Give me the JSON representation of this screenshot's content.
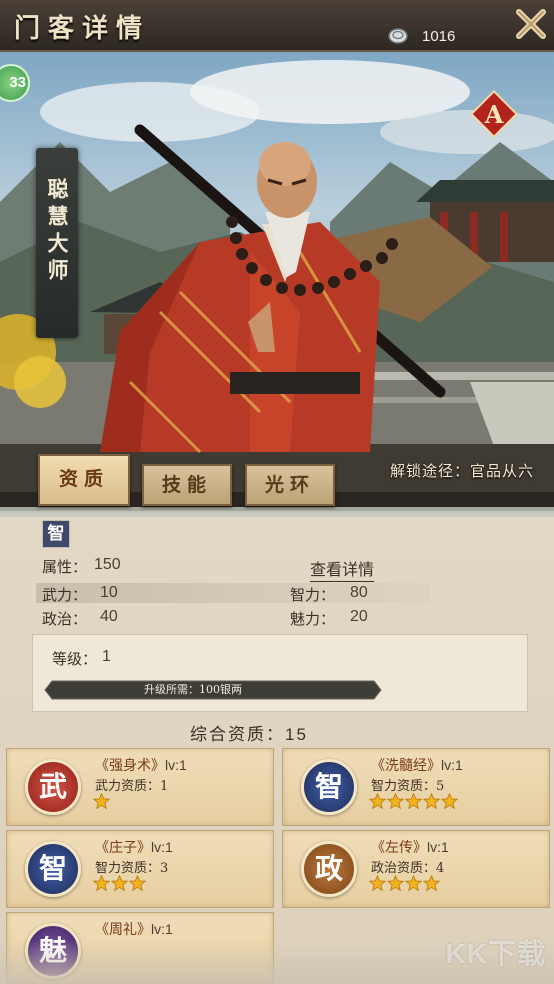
{
  "header": {
    "title": "门客详情",
    "currency_value": "1016",
    "currency_icon": "silver-coin-icon",
    "close_icon": "close-icon"
  },
  "hero": {
    "level": "33",
    "name": "聪慧大师",
    "rank": "A",
    "unlock_text": "解锁途径：官品从六"
  },
  "tabs": [
    {
      "label": "资质",
      "active": true
    },
    {
      "label": "技能",
      "active": false
    },
    {
      "label": "光环",
      "active": false
    }
  ],
  "attributes": {
    "type_icon": "智",
    "attr_label": "属性：",
    "attr_value": "150",
    "details_link": "查看详情",
    "stats": [
      {
        "label": "武力：",
        "value": "10"
      },
      {
        "label": "智力：",
        "value": "80"
      },
      {
        "label": "政治：",
        "value": "40"
      },
      {
        "label": "魅力：",
        "value": "20"
      }
    ]
  },
  "level_box": {
    "level_label": "等级：",
    "level_value": "1",
    "upgrade_label": "升级所需：100银两"
  },
  "overall": {
    "label": "综合资质：",
    "value": "15"
  },
  "skills": [
    {
      "emblem": "武",
      "name": "《强身术》",
      "level": "lv:1",
      "stat": "武力资质：1",
      "stars": 1,
      "color": "#b8322b"
    },
    {
      "emblem": "智",
      "name": "《洗髓经》",
      "level": "lv:1",
      "stat": "智力资质：5",
      "stars": 5,
      "color": "#2b3f78"
    },
    {
      "emblem": "智",
      "name": "《庄子》",
      "level": "lv:1",
      "stat": "智力资质：3",
      "stars": 3,
      "color": "#2b3f78"
    },
    {
      "emblem": "政",
      "name": "《左传》",
      "level": "lv:1",
      "stat": "政治资质：4",
      "stars": 4,
      "color": "#9a5a28"
    },
    {
      "emblem": "魅",
      "name": "《周礼》",
      "level": "lv:1",
      "stat": "",
      "stars": 0,
      "color": "#5b3a7a"
    }
  ],
  "watermark": "KK下载",
  "colors": {
    "panel_bg": "#e2d8c6",
    "card_bg": "#f0ddb8",
    "star": "#f2b21d",
    "header_bg": "#3a322b"
  }
}
